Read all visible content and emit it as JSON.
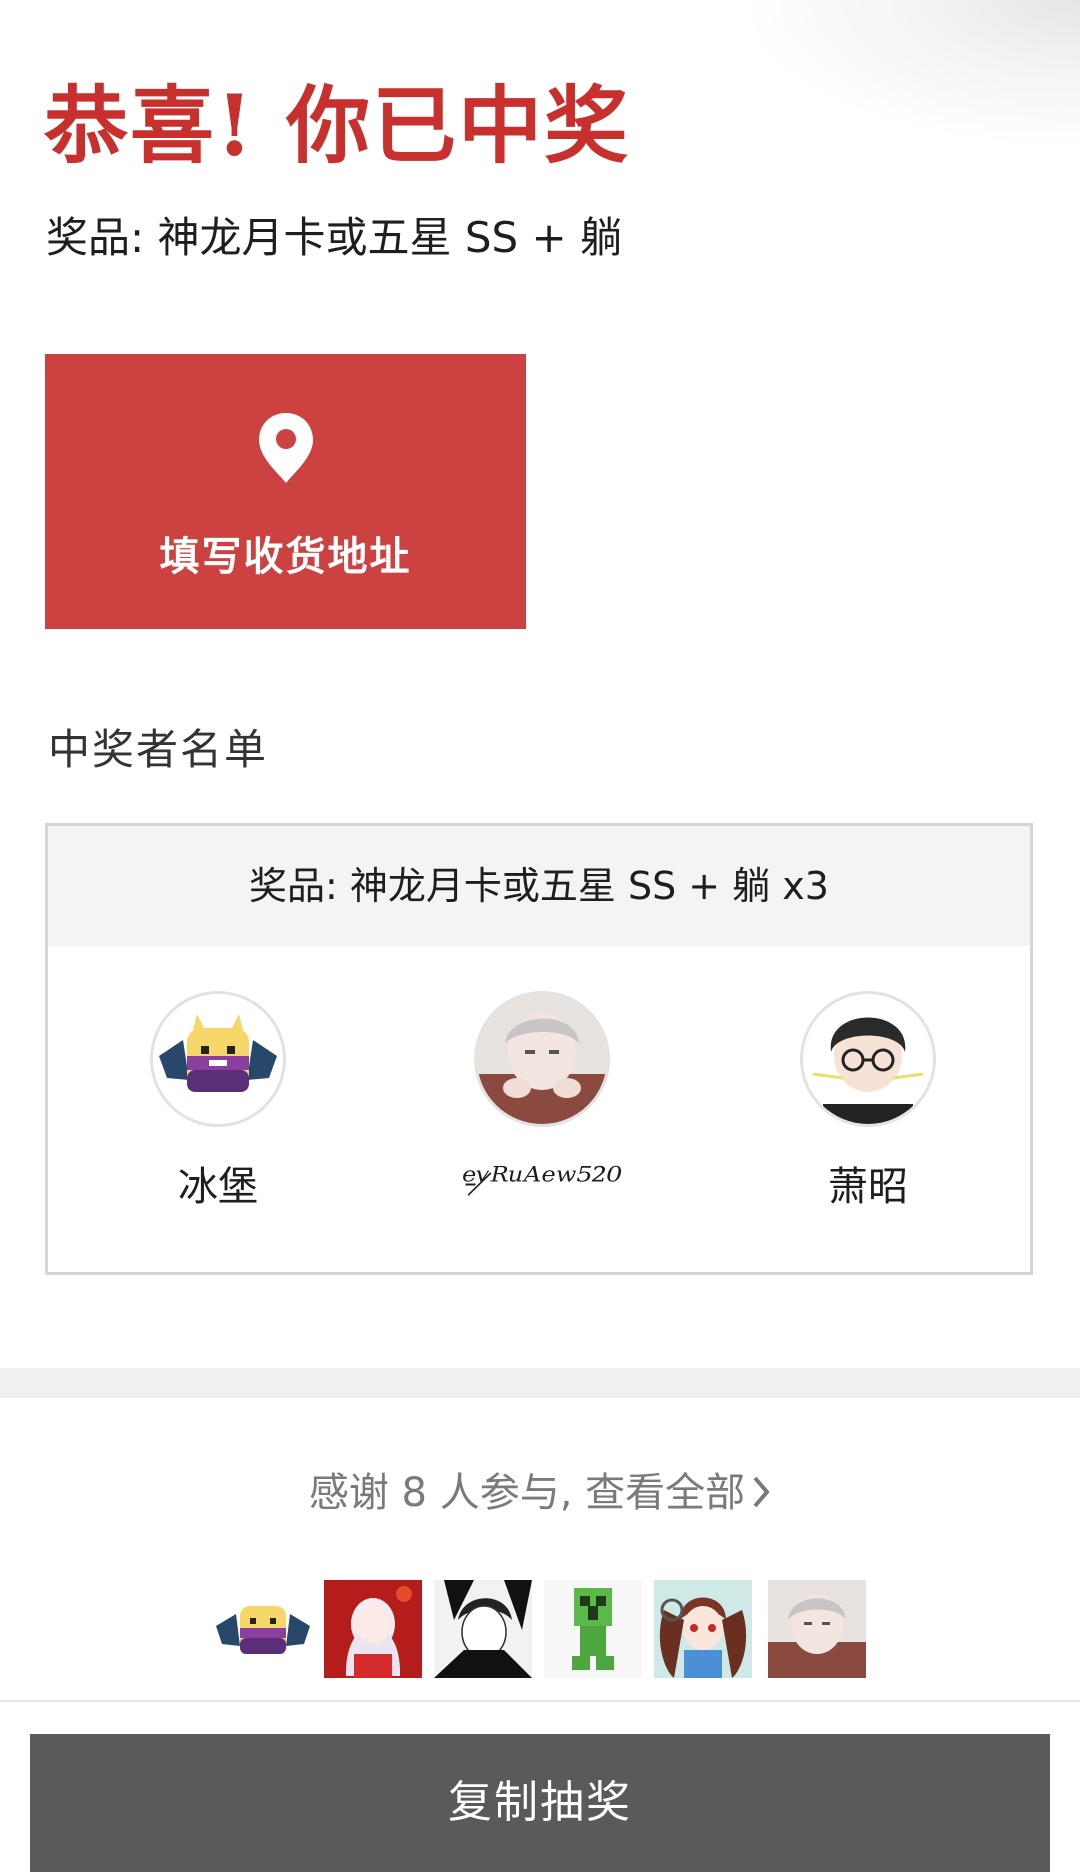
{
  "header": {
    "title": "恭喜! 你已中奖",
    "prize_line": "奖品: 神龙月卡或五星 SS + 躺"
  },
  "address_button": {
    "icon": "location-pin-icon",
    "label": "填写收货地址"
  },
  "winners": {
    "heading": "中奖者名单",
    "prize_header": "奖品: 神龙月卡或五星 SS + 躺 x3",
    "list": [
      {
        "name": "冰堡",
        "avatar": "pixel-demon-avatar"
      },
      {
        "name": "ᵉ̵ᵛ̷ᴿᵘᴬᵉʷ⁵²⁰",
        "avatar": "anime-boy-avatar"
      },
      {
        "name": "萧昭",
        "avatar": "glasses-boy-avatar"
      }
    ]
  },
  "participants": {
    "thanks_text": "感谢 8 人参与, 查看全部",
    "chevron_icon": "chevron-right-icon",
    "thumbnails": [
      "pixel-demon-avatar",
      "white-hair-girl-avatar",
      "manga-boy-avatar",
      "creeper-avatar",
      "twin-tail-girl-avatar",
      "anime-boy-avatar"
    ]
  },
  "copy_button": {
    "label": "复制抽奖"
  },
  "colors": {
    "brand_red": "#c8302e",
    "button_red": "#cc4240",
    "bottom_button": "#5a5a5a"
  }
}
